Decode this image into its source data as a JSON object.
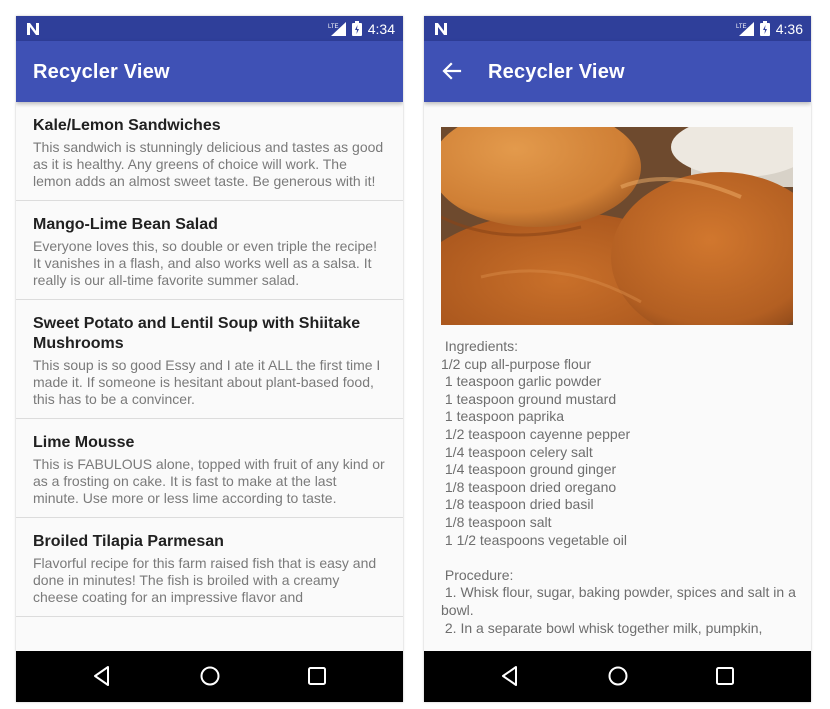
{
  "phones": {
    "list": {
      "status_time": "4:34",
      "app_title": "Recycler View",
      "recipes": [
        {
          "title": "Kale/Lemon Sandwiches",
          "description": "This sandwich is stunningly delicious and tastes as good as it is healthy. Any greens of choice will work. The lemon adds an almost sweet taste. Be generous with it!"
        },
        {
          "title": "Mango-Lime Bean Salad",
          "description": "Everyone loves this, so double or even triple the recipe! It vanishes in a flash, and also works well as a salsa. It really is our all-time favorite summer salad."
        },
        {
          "title": "Sweet Potato and Lentil Soup with Shiitake Mushrooms",
          "description": "This soup is so good Essy and I ate it ALL the first time I made it. If someone is hesitant about plant-based food, this has to be a convincer."
        },
        {
          "title": "Lime Mousse",
          "description": "This is FABULOUS alone, topped with fruit of any kind or as a frosting on cake. It is fast to make at the last minute. Use more or less lime according to taste."
        },
        {
          "title": "Broiled Tilapia Parmesan",
          "description": "Flavorful recipe for this farm raised fish that is easy and done in minutes! The fish is broiled with a creamy cheese coating for an impressive flavor and"
        }
      ]
    },
    "detail": {
      "status_time": "4:36",
      "app_title": "Recycler View",
      "image_subject": "pumpkin pancakes",
      "recipe_text": " Ingredients:\n1/2 cup all-purpose flour\n 1 teaspoon garlic powder\n 1 teaspoon ground mustard\n 1 teaspoon paprika\n 1/2 teaspoon cayenne pepper\n 1/4 teaspoon celery salt\n 1/4 teaspoon ground ginger\n 1/8 teaspoon dried oregano\n 1/8 teaspoon dried basil\n 1/8 teaspoon salt\n 1 1/2 teaspoons vegetable oil\n\n Procedure:\n 1. Whisk flour, sugar, baking powder, spices and salt in a bowl.\n 2. In a separate bowl whisk together milk, pumpkin,"
    }
  },
  "icons": {
    "status_logo": "n-logo-icon",
    "signal": "lte-signal-icon",
    "battery": "battery-icon",
    "back_arrow": "arrow-back-icon",
    "nav_back": "triangle-back-icon",
    "nav_home": "circle-home-icon",
    "nav_recents": "square-recents-icon"
  },
  "colors": {
    "status_bar": "#2f3f9a",
    "app_bar": "#3f51b5",
    "background": "#fafafa",
    "title_text": "#212121",
    "body_text": "#7a7a7a",
    "nav_bar": "#000000"
  }
}
